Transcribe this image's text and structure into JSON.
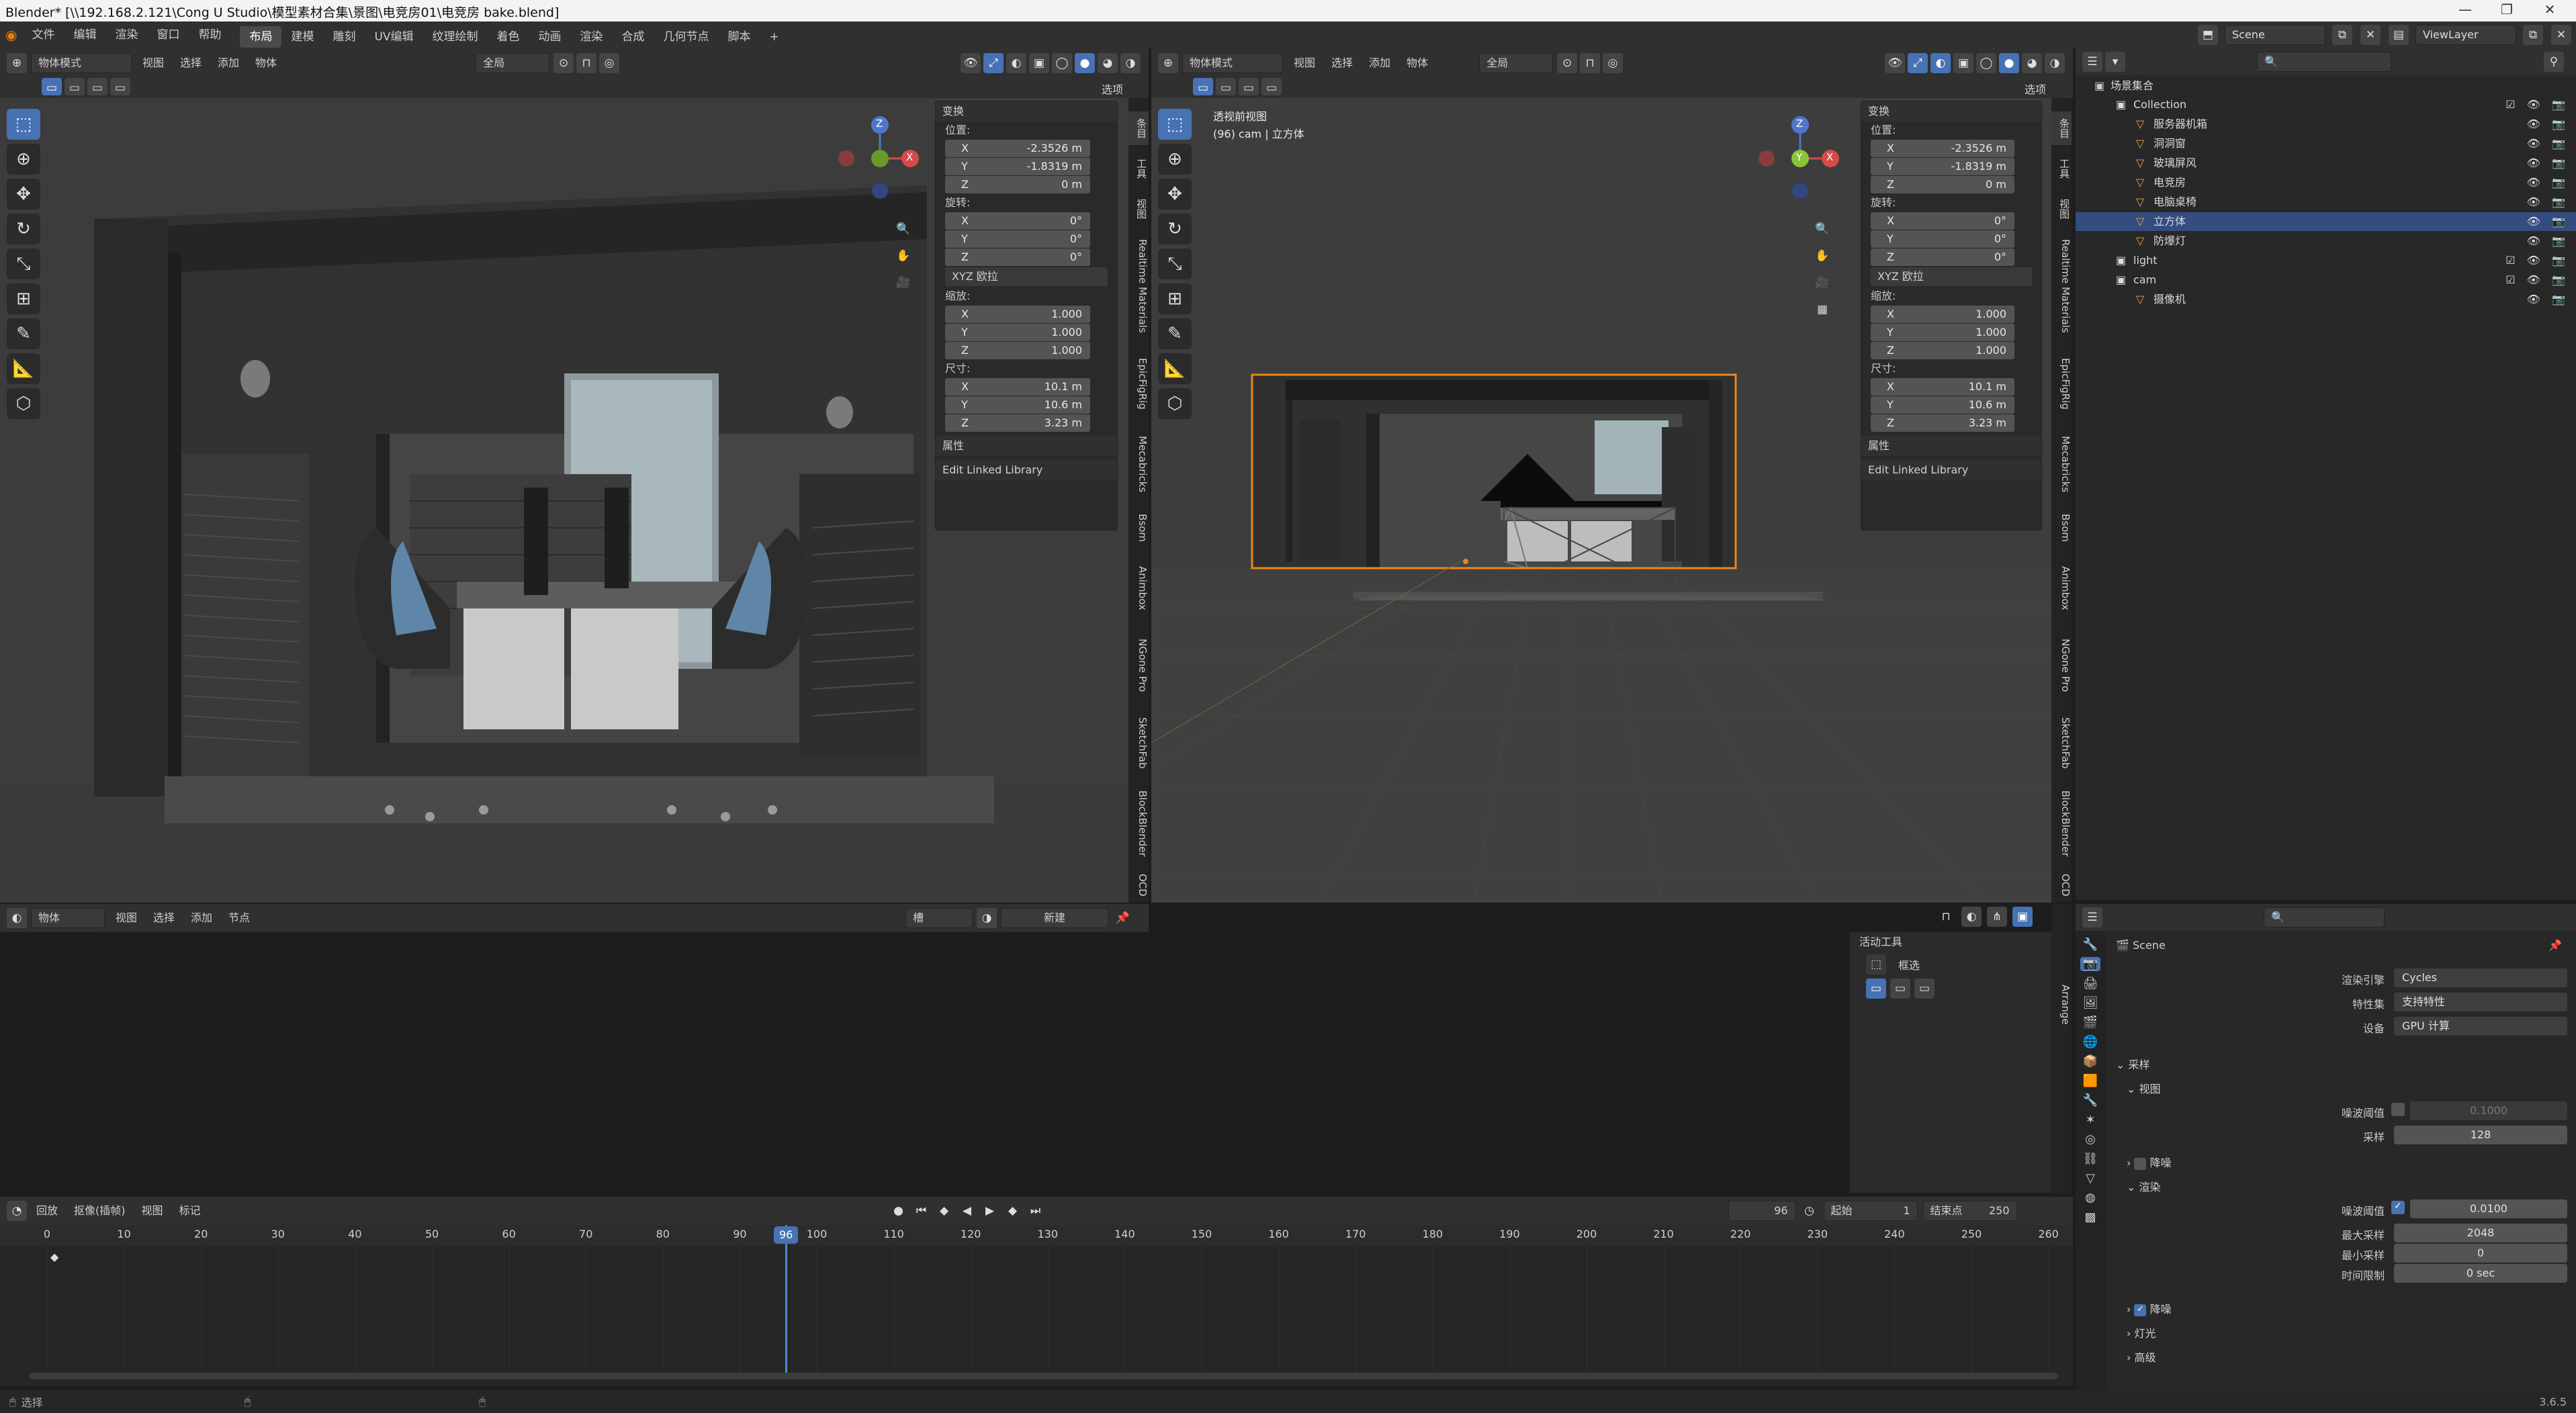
{
  "titlebar": {
    "title": "Blender* [\\\\192.168.2.121\\Cong U Studio\\模型素材合集\\景图\\电竞房01\\电竞房 bake.blend]",
    "minimize": "—",
    "maximize": "❐",
    "close": "✕"
  },
  "menu": {
    "items": [
      "文件",
      "编辑",
      "渲染",
      "窗口",
      "帮助"
    ]
  },
  "workspaces": {
    "tabs": [
      "布局",
      "建模",
      "雕刻",
      "UV编辑",
      "纹理绘制",
      "着色",
      "动画",
      "渲染",
      "合成",
      "几何节点",
      "脚本"
    ],
    "active": "布局",
    "add": "+"
  },
  "scene": {
    "name": "Scene",
    "view_layer": "ViewLayer"
  },
  "viewport_left": {
    "mode": "物体模式",
    "menus": [
      "视图",
      "选择",
      "添加",
      "物体"
    ],
    "orientation": "全局",
    "options_label": "选项",
    "gizmo": {
      "x": "X",
      "y": "Y",
      "z": "Z"
    }
  },
  "viewport_right": {
    "mode": "物体模式",
    "menus": [
      "视图",
      "选择",
      "添加",
      "物体"
    ],
    "orientation": "全局",
    "options_label": "选项",
    "view_name": "透视前视图",
    "view_info": "(96) cam | 立方体",
    "gizmo": {
      "x": "X",
      "y": "Y",
      "z": "Z"
    }
  },
  "transform": {
    "title": "变换",
    "location_label": "位置:",
    "location": {
      "x": "-2.3526 m",
      "y": "-1.8319 m",
      "z": "0 m"
    },
    "rotation_label": "旋转:",
    "rotation": {
      "x": "0°",
      "y": "0°",
      "z": "0°"
    },
    "rotation_mode": "XYZ 欧拉",
    "scale_label": "缩放:",
    "scale": {
      "x": "1.000",
      "y": "1.000",
      "z": "1.000"
    },
    "dimensions_label": "尺寸:",
    "dimensions": {
      "x": "10.1 m",
      "y": "10.6 m",
      "z": "3.23 m"
    },
    "axis": {
      "x": "X",
      "y": "Y",
      "z": "Z"
    },
    "properties_label": "属性",
    "linked_library_label": "Edit Linked Library"
  },
  "sidebar_tabs": [
    "条目",
    "工具",
    "视图",
    "Realtime Materials",
    "EpicFigRig",
    "Mecabricks",
    "Bsom",
    "Animbox",
    "NGone Pro",
    "SketchFab",
    "BlockBlender",
    "OCD"
  ],
  "outliner": {
    "root": "场景集合",
    "items": [
      {
        "label": "Collection",
        "indent": 1,
        "selected": false
      },
      {
        "label": "服务器机箱",
        "indent": 2,
        "selected": false
      },
      {
        "label": "洞洞窗",
        "indent": 2,
        "selected": false
      },
      {
        "label": "玻璃屏风",
        "indent": 2,
        "selected": false
      },
      {
        "label": "电竞房",
        "indent": 2,
        "selected": false
      },
      {
        "label": "电脑桌椅",
        "indent": 2,
        "selected": false
      },
      {
        "label": "立方体",
        "indent": 2,
        "selected": true
      },
      {
        "label": "防爆灯",
        "indent": 2,
        "selected": false
      },
      {
        "label": "light",
        "indent": 1,
        "selected": false
      },
      {
        "label": "cam",
        "indent": 1,
        "selected": false
      },
      {
        "label": "摄像机",
        "indent": 2,
        "selected": false
      }
    ]
  },
  "shader_editor": {
    "mode": "物体",
    "menus": [
      "视图",
      "选择",
      "添加",
      "节点"
    ],
    "slot": "槽",
    "new_label": "新建",
    "active_tool_title": "活动工具",
    "active_tool_name": "框选",
    "side_tab": "Arrange"
  },
  "properties": {
    "header": "Scene",
    "render_engine_label": "渲染引擎",
    "render_engine": "Cycles",
    "feature_set_label": "特性集",
    "feature_set": "支持特性",
    "device_label": "设备",
    "device": "GPU 计算",
    "sampling_title": "采样",
    "viewport_title": "视图",
    "noise_threshold_label": "噪波阈值",
    "viewport_noise_threshold": "0.1000",
    "samples_label": "采样",
    "viewport_samples": "128",
    "denoise_label": "降噪",
    "render_title": "渲染",
    "render_noise_threshold": "0.0100",
    "max_samples_label": "最大采样",
    "max_samples": "2048",
    "min_samples_label": "最小采样",
    "min_samples": "0",
    "time_limit_label": "时间限制",
    "time_limit": "0 sec",
    "render_denoise_label": "降噪",
    "lights_label": "灯光",
    "advanced_label": "高级"
  },
  "timeline": {
    "menus": [
      "回放",
      "抠像(插帧)",
      "视图",
      "标记"
    ],
    "current_frame": "96",
    "start_label": "起始",
    "start": "1",
    "end_label": "结束点",
    "end": "250",
    "ruler": [
      "0",
      "10",
      "20",
      "30",
      "40",
      "50",
      "60",
      "70",
      "80",
      "90",
      "100",
      "110",
      "120",
      "130",
      "140",
      "150",
      "160",
      "170",
      "180",
      "190",
      "200",
      "210",
      "220",
      "230",
      "240",
      "250",
      "260"
    ],
    "playhead_label": "96"
  },
  "statusbar": {
    "left": "选择",
    "version": "3.6.5"
  }
}
